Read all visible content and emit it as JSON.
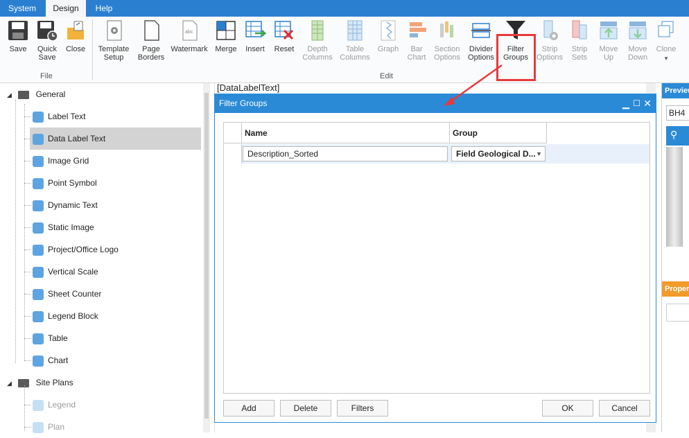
{
  "menu": {
    "tabs": [
      "System",
      "Design",
      "Help"
    ]
  },
  "ribbon": {
    "buttons": [
      {
        "label": "Save",
        "icon": "save-icon"
      },
      {
        "label": "Quick Save",
        "icon": "quick-save-icon"
      },
      {
        "label": "Close",
        "icon": "close-folder-icon"
      },
      {
        "label": "Template Setup",
        "icon": "template-setup-icon"
      },
      {
        "label": "Page Borders",
        "icon": "page-borders-icon"
      },
      {
        "label": "Watermark",
        "icon": "watermark-icon"
      },
      {
        "label": "Merge",
        "icon": "merge-icon"
      },
      {
        "label": "Insert",
        "icon": "insert-icon"
      },
      {
        "label": "Reset",
        "icon": "reset-icon"
      },
      {
        "label": "Depth Columns",
        "icon": "depth-columns-icon"
      },
      {
        "label": "Table Columns",
        "icon": "table-columns-icon"
      },
      {
        "label": "Graph",
        "icon": "graph-icon"
      },
      {
        "label": "Bar Chart",
        "icon": "bar-chart-icon"
      },
      {
        "label": "Section Options",
        "icon": "section-options-icon"
      },
      {
        "label": "Divider Options",
        "icon": "divider-options-icon"
      },
      {
        "label": "Filter Groups",
        "icon": "filter-icon"
      },
      {
        "label": "Strip Options",
        "icon": "strip-options-icon"
      },
      {
        "label": "Strip Sets",
        "icon": "strip-sets-icon"
      },
      {
        "label": "Move Up",
        "icon": "move-up-icon"
      },
      {
        "label": "Move Down",
        "icon": "move-down-icon"
      },
      {
        "label": "Clone",
        "icon": "clone-icon"
      }
    ],
    "groups": {
      "file": "File",
      "edit": "Edit"
    }
  },
  "tree": {
    "general": "General",
    "general_items": [
      "Label Text",
      "Data Label Text",
      "Image Grid",
      "Point Symbol",
      "Dynamic Text",
      "Static Image",
      "Project/Office Logo",
      "Vertical Scale",
      "Sheet Counter",
      "Legend Block",
      "Table",
      "Chart"
    ],
    "site_plans": "Site Plans",
    "site_items": [
      "Legend",
      "Plan"
    ]
  },
  "editor": {
    "field_text": "[DataLabelText]"
  },
  "dialog": {
    "title": "Filter Groups",
    "columns": {
      "name": "Name",
      "group": "Group"
    },
    "row": {
      "name": "Description_Sorted",
      "group": "Field Geological D..."
    },
    "buttons": {
      "add": "Add",
      "delete": "Delete",
      "filters": "Filters",
      "ok": "OK",
      "cancel": "Cancel"
    }
  },
  "right_panel": {
    "preview": "Preview",
    "borehole": "BH4",
    "properties": "Properties"
  },
  "colors": {
    "accent": "#2b8ad6",
    "highlight": "#e8393a"
  }
}
